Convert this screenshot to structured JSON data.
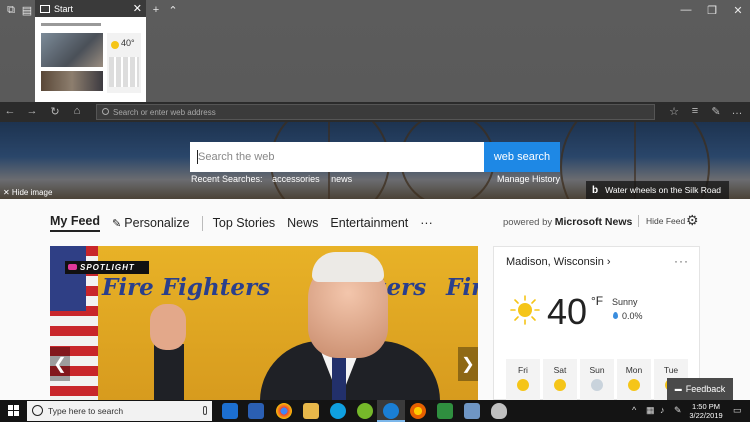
{
  "tab": {
    "title": "Start",
    "close": "✕"
  },
  "tabstrip": {
    "tabs_icon": "tabs-aside-icon",
    "preview_icon": "tab-preview-icon",
    "new_tab": "+",
    "collapse": "⌃",
    "window_controls": {
      "minimize": "—",
      "restore": "❐",
      "close": "✕"
    }
  },
  "thumb": {
    "temp": "40°"
  },
  "navbar": {
    "back": "←",
    "forward": "→",
    "refresh": "↻",
    "home": "⌂",
    "address_placeholder": "Search or enter web address",
    "favorites": "☆",
    "reading_list": "≡",
    "notes": "✎",
    "share": "↗",
    "more": "…"
  },
  "hero": {
    "search_placeholder": "Search the web",
    "search_button": "web search",
    "recent_label": "Recent Searches:",
    "recent_items": [
      "accessories",
      "news"
    ],
    "manage_history": "Manage History",
    "hide_image": "✕ Hide image",
    "caption_logo": "b",
    "caption": "Water wheels on the Silk Road"
  },
  "feed": {
    "tabs": [
      "My Feed",
      "Personalize",
      "Top Stories",
      "News",
      "Entertainment",
      "···"
    ],
    "powered_by": "powered by",
    "powered_brand": "Microsoft News",
    "hide_feed": "Hide Feed",
    "settings": "⚙"
  },
  "story": {
    "badge": "SPOTLIGHT",
    "banner_text": [
      "Fire Fighters",
      "Fighters",
      "Fire"
    ],
    "prev": "❮",
    "next": "❯"
  },
  "weather": {
    "location": "Madison, Wisconsin ›",
    "more": "···",
    "temp": "40",
    "unit": "°F",
    "condition": "Sunny",
    "precip": "0.0%",
    "days": [
      "Fri",
      "Sat",
      "Sun",
      "Mon",
      "Tue"
    ]
  },
  "feedback": "Feedback",
  "taskbar": {
    "search_placeholder": "Type here to search",
    "time": "1:50 PM",
    "date": "3/22/2019",
    "tray": {
      "chevron": "^",
      "notify": "▭"
    }
  },
  "colors": {
    "accent": "#1e88e5",
    "tab_bg": "#5a5a5a",
    "address_bg": "#2b2b2b",
    "taskbar_bg": "#141414",
    "sun": "#f5c518"
  }
}
